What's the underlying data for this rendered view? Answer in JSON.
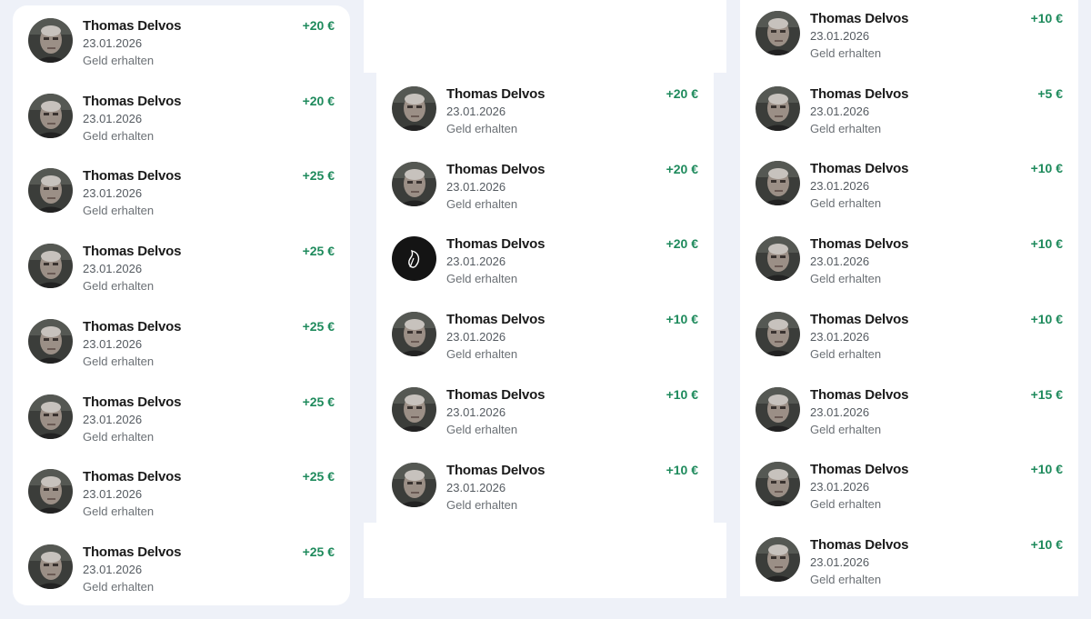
{
  "columns": [
    {
      "id": "left",
      "items": [
        {
          "name": "Thomas Delvos",
          "date": "23.01.2026",
          "description": "Geld erhalten",
          "amount": "+20 €",
          "avatar": "person-photo"
        },
        {
          "name": "Thomas Delvos",
          "date": "23.01.2026",
          "description": "Geld erhalten",
          "amount": "+20 €",
          "avatar": "person-photo"
        },
        {
          "name": "Thomas Delvos",
          "date": "23.01.2026",
          "description": "Geld erhalten",
          "amount": "+25 €",
          "avatar": "person-photo"
        },
        {
          "name": "Thomas Delvos",
          "date": "23.01.2026",
          "description": "Geld erhalten",
          "amount": "+25 €",
          "avatar": "person-photo"
        },
        {
          "name": "Thomas Delvos",
          "date": "23.01.2026",
          "description": "Geld erhalten",
          "amount": "+25 €",
          "avatar": "person-photo"
        },
        {
          "name": "Thomas Delvos",
          "date": "23.01.2026",
          "description": "Geld erhalten",
          "amount": "+25 €",
          "avatar": "person-photo"
        },
        {
          "name": "Thomas Delvos",
          "date": "23.01.2026",
          "description": "Geld erhalten",
          "amount": "+25 €",
          "avatar": "person-photo"
        },
        {
          "name": "Thomas Delvos",
          "date": "23.01.2026",
          "description": "Geld erhalten",
          "amount": "+25 €",
          "avatar": "person-photo"
        }
      ]
    },
    {
      "id": "middle",
      "items": [
        {
          "name": "Thomas Delvos",
          "date": "23.01.2026",
          "description": "Geld erhalten",
          "amount": "+20 €",
          "avatar": "person-photo"
        },
        {
          "name": "Thomas Delvos",
          "date": "23.01.2026",
          "description": "Geld erhalten",
          "amount": "+20 €",
          "avatar": "person-photo"
        },
        {
          "name": "Thomas Delvos",
          "date": "23.01.2026",
          "description": "Geld erhalten",
          "amount": "+20 €",
          "avatar": "leaf-logo"
        },
        {
          "name": "Thomas Delvos",
          "date": "23.01.2026",
          "description": "Geld erhalten",
          "amount": "+10 €",
          "avatar": "person-photo"
        },
        {
          "name": "Thomas Delvos",
          "date": "23.01.2026",
          "description": "Geld erhalten",
          "amount": "+10 €",
          "avatar": "person-photo"
        },
        {
          "name": "Thomas Delvos",
          "date": "23.01.2026",
          "description": "Geld erhalten",
          "amount": "+10 €",
          "avatar": "person-photo"
        }
      ]
    },
    {
      "id": "right",
      "items": [
        {
          "name": "Thomas Delvos",
          "date": "23.01.2026",
          "description": "Geld erhalten",
          "amount": "+10 €",
          "avatar": "person-photo"
        },
        {
          "name": "Thomas Delvos",
          "date": "23.01.2026",
          "description": "Geld erhalten",
          "amount": "+5 €",
          "avatar": "person-photo"
        },
        {
          "name": "Thomas Delvos",
          "date": "23.01.2026",
          "description": "Geld erhalten",
          "amount": "+10 €",
          "avatar": "person-photo"
        },
        {
          "name": "Thomas Delvos",
          "date": "23.01.2026",
          "description": "Geld erhalten",
          "amount": "+10 €",
          "avatar": "person-photo"
        },
        {
          "name": "Thomas Delvos",
          "date": "23.01.2026",
          "description": "Geld erhalten",
          "amount": "+10 €",
          "avatar": "person-photo"
        },
        {
          "name": "Thomas Delvos",
          "date": "23.01.2026",
          "description": "Geld erhalten",
          "amount": "+15 €",
          "avatar": "person-photo"
        },
        {
          "name": "Thomas Delvos",
          "date": "23.01.2026",
          "description": "Geld erhalten",
          "amount": "+10 €",
          "avatar": "person-photo"
        },
        {
          "name": "Thomas Delvos",
          "date": "23.01.2026",
          "description": "Geld erhalten",
          "amount": "+10 €",
          "avatar": "person-photo"
        }
      ]
    }
  ],
  "colors": {
    "amount_positive": "#1e8a5c",
    "page_background": "#eef1f8",
    "card_background": "#ffffff"
  }
}
